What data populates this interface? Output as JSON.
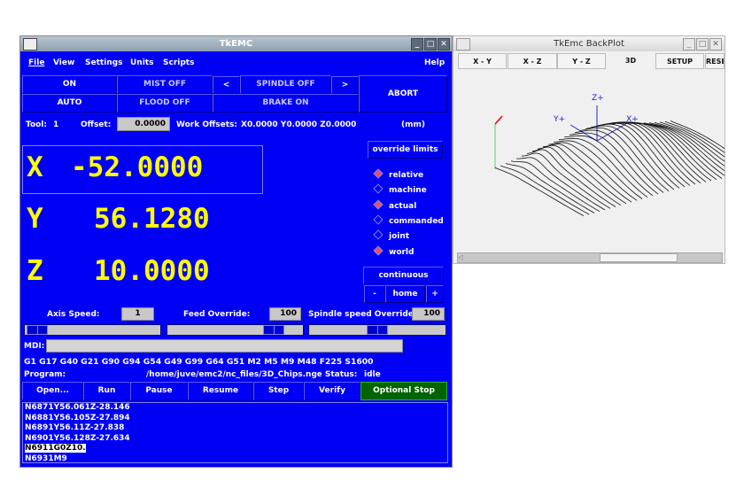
{
  "main": {
    "title": "TkEMC",
    "menu": [
      "File",
      "View",
      "Settings",
      "Units",
      "Scripts"
    ],
    "help": "Help",
    "buttons": {
      "on": "ON",
      "mist": "MIST OFF",
      "prev": "<",
      "spindle": "SPINDLE OFF",
      "next": ">",
      "abort": "ABORT",
      "auto": "AUTO",
      "flood": "FLOOD OFF",
      "brake": "BRAKE ON"
    },
    "tool_label": "Tool:",
    "tool_value": "1",
    "offset_label": "Offset:",
    "offset_value": "0.0000",
    "work_offsets_label": "Work Offsets:",
    "work_offsets": "X0.0000 Y0.0000 Z0.0000",
    "units": "(mm)",
    "axes": [
      {
        "name": "X",
        "value": "-52.0000"
      },
      {
        "name": "Y",
        "value": "56.1280"
      },
      {
        "name": "Z",
        "value": "10.0000"
      }
    ],
    "override_limits": "override limits",
    "radios": [
      {
        "label": "relative",
        "on": true
      },
      {
        "label": "machine",
        "on": false
      },
      {
        "label": "actual",
        "on": true
      },
      {
        "label": "commanded",
        "on": false
      },
      {
        "label": "joint",
        "on": false
      },
      {
        "label": "world",
        "on": true
      }
    ],
    "jog": {
      "mode": "continuous",
      "minus": "-",
      "home": "home",
      "plus": "+"
    },
    "axis_speed_label": "Axis Speed:",
    "axis_speed": "1",
    "feed_override_label": "Feed Override:",
    "feed_override": "100",
    "spindle_override_label": "Spindle speed Override:",
    "spindle_override": "100",
    "mdi_label": "MDI:",
    "mdi_value": "",
    "gcodes": "G1 G17 G40 G21 G90 G94 G54 G49 G99 G64 G51 M2 M5 M9 M48 F225 S1600",
    "program_label": "Program:",
    "program_path": "/home/juve/emc2/nc_files/3D_Chips.ngc",
    "status_label": "-  Status:",
    "status": "idle",
    "actions": [
      "Open...",
      "Run",
      "Pause",
      "Resume",
      "Step",
      "Verify",
      "Optional Stop"
    ],
    "log": [
      "N6871Y56.061Z-28.146",
      "N6881Y56.105Z-27.894",
      "N6891Y56.11Z-27.838",
      "N6901Y56.128Z-27.634",
      "N6911G0Z10.",
      "N6931M9"
    ]
  },
  "backplot": {
    "title": "TkEmc BackPlot",
    "tabs": [
      "X - Y",
      "X - Z",
      "Y - Z",
      "3D",
      "SETUP",
      "RESET"
    ],
    "axis_labels": {
      "z": "Z+",
      "y": "Y+",
      "x": "X+"
    }
  },
  "colors": {
    "panel": "#0000f5",
    "readout": "#ffff00",
    "optional_stop": "#006400"
  }
}
